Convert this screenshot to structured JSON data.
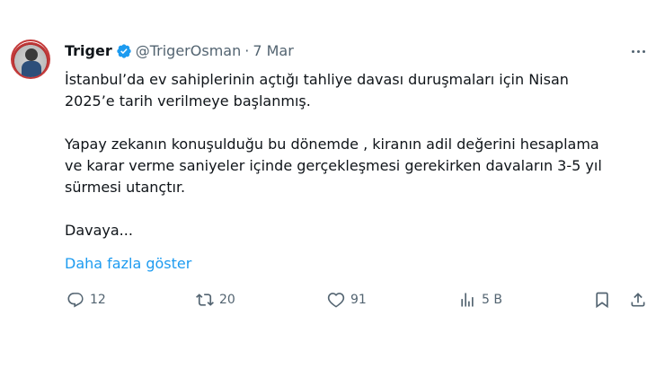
{
  "author": {
    "name": "Triger",
    "handle": "@TrigerOsman",
    "separator": "·",
    "date": "7 Mar"
  },
  "tweet": {
    "paragraph1_line1": "İstanbul’da ev sahiplerinin açtığı tahliye davası duruşmaları için Nisan",
    "paragraph1_line2": "2025’e tarih verilmeye başlanmış.",
    "paragraph2_line1": "Yapay zekanın konuşulduğu bu dönemde , kiranın adil değerini hesaplama",
    "paragraph2_line2": "ve karar verme saniyeler içinde gerçekleşmesi gerekirken davaların 3-5 yıl",
    "paragraph2_line3": "sürmesi utançtır.",
    "paragraph3_line1": "Davaya...",
    "show_more": "Daha fazla göster"
  },
  "actions": {
    "replies": "12",
    "reposts": "20",
    "likes": "91",
    "views": "5 B"
  },
  "colors": {
    "text": "#0f1419",
    "secondary": "#536471",
    "link": "#1d9bf0",
    "verified": "#1d9bf0"
  },
  "icons": [
    "verified-badge-icon",
    "more-icon",
    "reply-icon",
    "repost-icon",
    "like-icon",
    "views-icon",
    "bookmark-icon",
    "share-icon"
  ]
}
